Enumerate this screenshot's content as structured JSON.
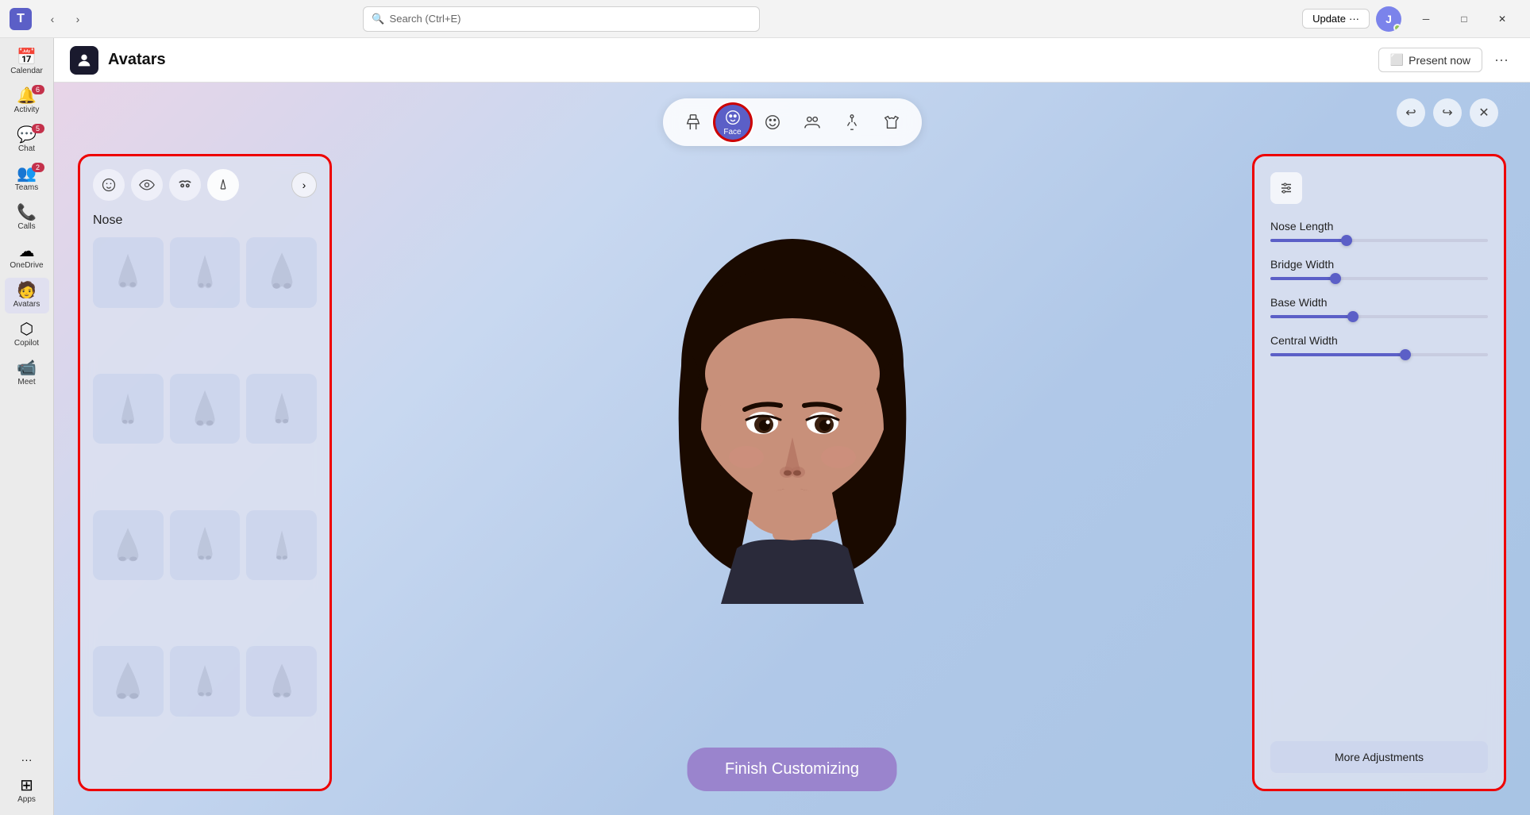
{
  "titlebar": {
    "logo": "T",
    "search_placeholder": "Search (Ctrl+E)",
    "update_label": "Update",
    "update_dots": "···",
    "minimize": "─",
    "maximize": "□",
    "close": "✕"
  },
  "sidebar": {
    "items": [
      {
        "id": "calendar",
        "label": "Calendar",
        "icon": "📅",
        "badge": null
      },
      {
        "id": "activity",
        "label": "Activity",
        "icon": "🔔",
        "badge": "6"
      },
      {
        "id": "chat",
        "label": "Chat",
        "icon": "💬",
        "badge": "5"
      },
      {
        "id": "teams",
        "label": "Teams",
        "icon": "👥",
        "badge": "2"
      },
      {
        "id": "calls",
        "label": "Calls",
        "icon": "📞",
        "badge": null
      },
      {
        "id": "onedrive",
        "label": "OneDrive",
        "icon": "☁",
        "badge": null
      },
      {
        "id": "avatars",
        "label": "Avatars",
        "icon": "🧑",
        "badge": null,
        "active": true
      },
      {
        "id": "copilot",
        "label": "Copilot",
        "icon": "⬡",
        "badge": null
      },
      {
        "id": "meet",
        "label": "Meet",
        "icon": "📹",
        "badge": null
      },
      {
        "id": "more",
        "label": "···",
        "icon": "···",
        "badge": null
      },
      {
        "id": "apps",
        "label": "Apps",
        "icon": "⊞",
        "badge": null
      }
    ]
  },
  "app_header": {
    "icon": "🧑",
    "title": "Avatars",
    "present_now_label": "Present now",
    "more_icon": "···"
  },
  "toolbar": {
    "tabs": [
      {
        "id": "body",
        "icon": "🕴",
        "label": "",
        "active": false
      },
      {
        "id": "face",
        "icon": "😐",
        "label": "Face",
        "active": true
      },
      {
        "id": "expressions",
        "icon": "😊",
        "label": "",
        "active": false
      },
      {
        "id": "group",
        "icon": "👥",
        "label": "",
        "active": false
      },
      {
        "id": "pose",
        "icon": "🖐",
        "label": "",
        "active": false
      },
      {
        "id": "clothing",
        "icon": "👕",
        "label": "",
        "active": false
      }
    ],
    "undo_icon": "↩",
    "redo_icon": "↪",
    "close_icon": "✕"
  },
  "left_panel": {
    "tabs": [
      {
        "id": "face-shape",
        "icon": "🙂"
      },
      {
        "id": "eyes",
        "icon": "👁"
      },
      {
        "id": "eyebrows",
        "icon": "〰"
      },
      {
        "id": "nose",
        "icon": "👃",
        "active": true
      }
    ],
    "section_title": "Nose",
    "nose_items_count": 12
  },
  "right_panel": {
    "sliders": [
      {
        "id": "nose-length",
        "label": "Nose Length",
        "value": 35
      },
      {
        "id": "bridge-width",
        "label": "Bridge Width",
        "value": 30
      },
      {
        "id": "base-width",
        "label": "Base Width",
        "value": 38
      },
      {
        "id": "central-width",
        "label": "Central Width",
        "value": 62
      }
    ],
    "more_adjustments_label": "More Adjustments"
  },
  "finish_button": {
    "label": "Finish Customizing"
  }
}
